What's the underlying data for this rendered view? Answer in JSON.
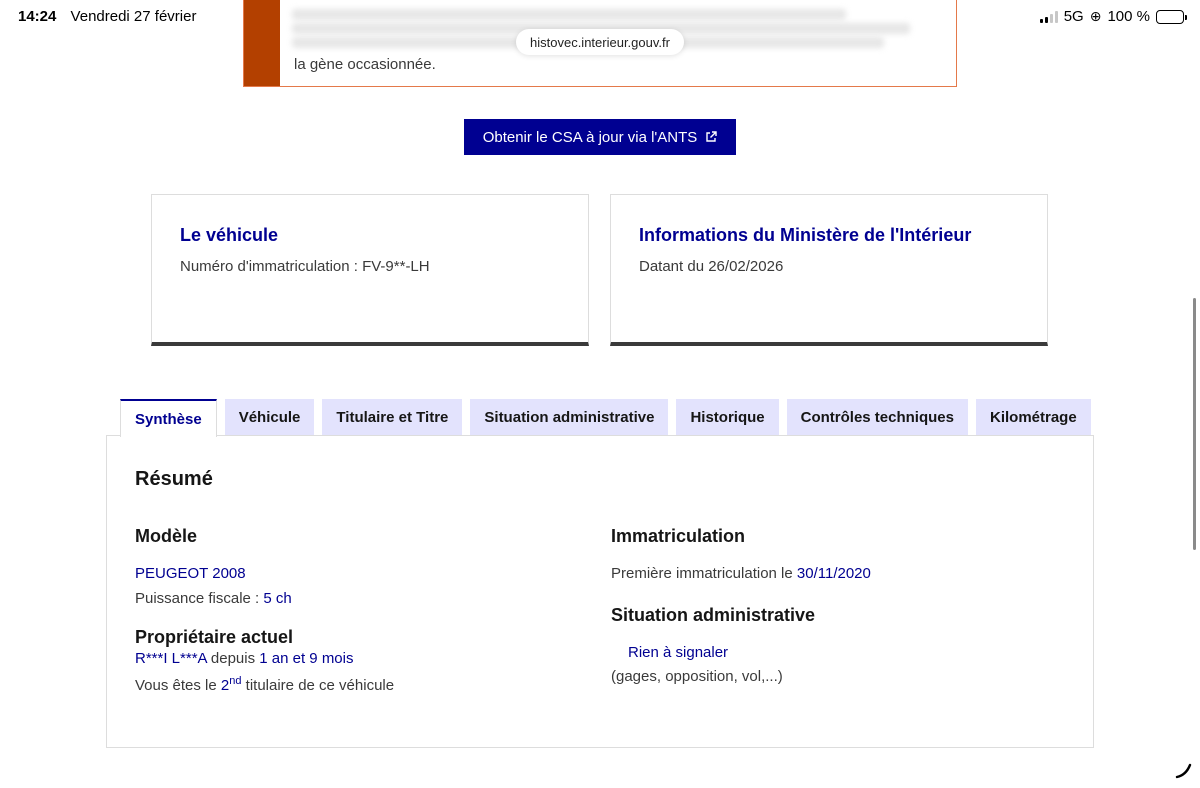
{
  "status": {
    "time": "14:24",
    "date": "Vendredi 27 février",
    "network": "5G",
    "battery": "100 %"
  },
  "browser": {
    "url": "histovec.interieur.gouv.fr"
  },
  "alert": {
    "last_line": "la gène occasionnée."
  },
  "csa_button": {
    "label": "Obtenir le CSA à jour via l'ANTS"
  },
  "vehicle_card": {
    "title": "Le véhicule",
    "text": "Numéro d'immatriculation : FV-9**-LH"
  },
  "ministry_card": {
    "title": "Informations du Ministère de l'Intérieur",
    "text": "Datant du 26/02/2026"
  },
  "tabs": [
    {
      "label": "Synthèse"
    },
    {
      "label": "Véhicule"
    },
    {
      "label": "Titulaire et Titre"
    },
    {
      "label": "Situation administrative"
    },
    {
      "label": "Historique"
    },
    {
      "label": "Contrôles techniques"
    },
    {
      "label": "Kilométrage"
    }
  ],
  "summary": {
    "title": "Résumé",
    "model": {
      "heading": "Modèle",
      "name": "PEUGEOT 2008",
      "power_label": "Puissance fiscale : ",
      "power_value": "5 ch"
    },
    "owner": {
      "heading": "Propriétaire actuel",
      "name": "R***I L***A",
      "since_label": " depuis ",
      "since_value": "1 an et 9 mois",
      "rank_prefix": "Vous êtes le ",
      "rank_num": "2",
      "rank_sup": "nd",
      "rank_suffix": " titulaire de ce véhicule"
    },
    "registration": {
      "heading": "Immatriculation",
      "label": "Première immatriculation le ",
      "date": "30/11/2020"
    },
    "admin": {
      "heading": "Situation administrative",
      "status": "Rien à signaler",
      "detail": "(gages, opposition, vol,...)"
    }
  }
}
